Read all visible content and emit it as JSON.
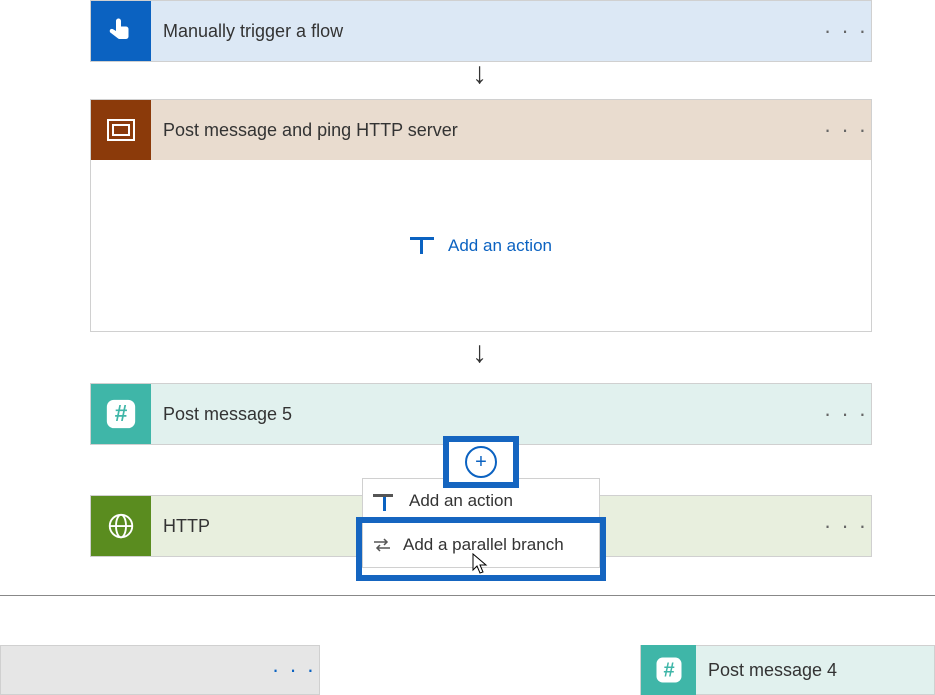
{
  "steps": {
    "trigger": {
      "title": "Manually trigger a flow",
      "bg": "#0b62c1"
    },
    "scope": {
      "title": "Post message and ping HTTP server",
      "bg": "#8b3a0a",
      "add_action": "Add an action"
    },
    "post5": {
      "title": "Post message 5",
      "bg": "#3fb6a8"
    },
    "http": {
      "title": "HTTP",
      "bg": "#5a8c1f"
    }
  },
  "context_menu": {
    "add_action": "Add an action",
    "add_parallel": "Add a parallel branch"
  },
  "branches": {
    "left": {
      "title": ""
    },
    "right": {
      "title": "Post message 4",
      "bg": "#3fb6a8"
    }
  }
}
